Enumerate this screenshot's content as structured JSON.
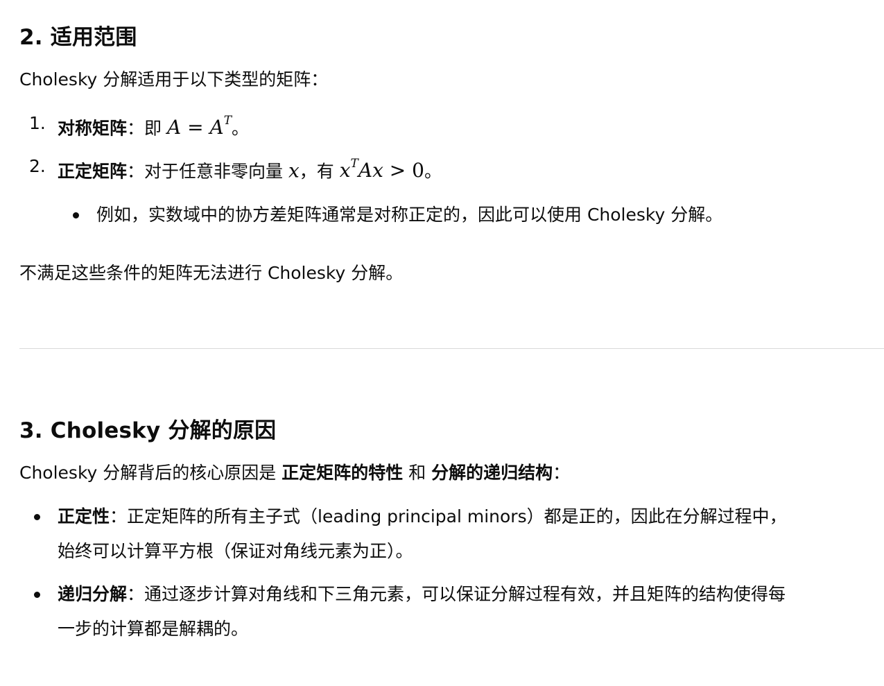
{
  "section2": {
    "heading": "2. 适用范围",
    "intro": "Cholesky 分解适用于以下类型的矩阵：",
    "items": [
      {
        "num": "1.",
        "bold": "对称矩阵",
        "colon": "：即 ",
        "math_a": "A",
        "math_eq": " = ",
        "math_b": "A",
        "math_sup": "T",
        "tail": "。"
      },
      {
        "num": "2.",
        "bold": "正定矩阵",
        "colon": "：对于任意非零向量 ",
        "math_x": "x",
        "mid": "，有 ",
        "math_x2": "x",
        "math_sup": "T",
        "math_ax": "Ax",
        "math_gt": " > ",
        "math_zero": "0",
        "tail": "。"
      }
    ],
    "subbullet": "例如，实数域中的协方差矩阵通常是对称正定的，因此可以使用 Cholesky 分解。",
    "closing": "不满足这些条件的矩阵无法进行 Cholesky 分解。"
  },
  "section3": {
    "heading": "3. Cholesky 分解的原因",
    "intro_a": "Cholesky 分解背后的核心原因是 ",
    "intro_b1": "正定矩阵的特性",
    "intro_and": " 和 ",
    "intro_b2": "分解的递归结构",
    "intro_end": "：",
    "bullets": [
      {
        "bold": "正定性",
        "line1": "：正定矩阵的所有主子式（leading principal minors）都是正的，因此在分解过程中，",
        "line2": "始终可以计算平方根（保证对角线元素为正）。"
      },
      {
        "bold": "递归分解",
        "line1": "：通过逐步计算对角线和下三角元素，可以保证分解过程有效，并且矩阵的结构使得每",
        "line2": "一步的计算都是解耦的。"
      }
    ]
  }
}
